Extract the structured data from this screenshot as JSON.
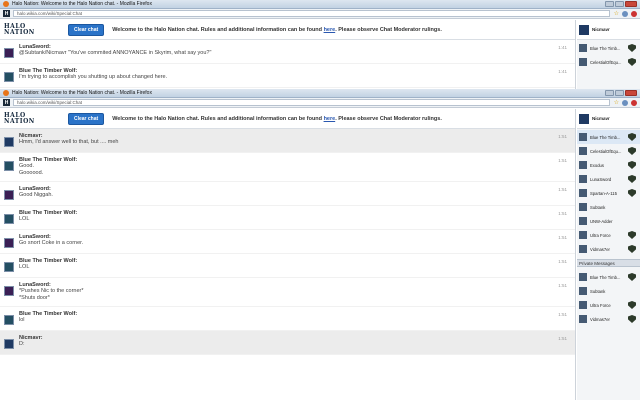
{
  "window": {
    "title": "Halo Nation: Welcome to the Halo Nation chat. - Mozilla Firefox",
    "url": "halo.wikia.com/wiki/Special:Chat"
  },
  "header": {
    "logo_line1": "HALO",
    "logo_line2": "NATION",
    "clear_chat_label": "Clear chat",
    "welcome_prefix": "Welcome to the Halo Nation chat. Rules and additional information can be found",
    "welcome_link": "here",
    "welcome_suffix": ". Please observe Chat Moderator rulings."
  },
  "back_window": {
    "messages": [
      {
        "author": "LunaSword:",
        "text": "@Subtank/Nicmavr \"You've commited ANNOYANCE in Skyrim, what say you?\"",
        "time": "1:41"
      },
      {
        "author": "Blue The Timber Wolf:",
        "text": "I'm trying to accomplish you shutting up about changed here.",
        "time": "1:41"
      }
    ],
    "self_user": "Nicmavr",
    "users": [
      "Blue The Timb...",
      "CelestialOfEqu..."
    ]
  },
  "front_window": {
    "partial_line": "Hmm, I'd answer well to that, but....",
    "messages": [
      {
        "author": "Nicmavr:",
        "text": [
          "Hmm, I'd answer well to that, but .... meh"
        ],
        "time": "1:51",
        "highlight": true
      },
      {
        "author": "Blue The Timber Wolf:",
        "text": [
          "Good.",
          "Goooood."
        ],
        "time": "1:51",
        "highlight": false
      },
      {
        "author": "LunaSword:",
        "text": [
          "Good Niggah."
        ],
        "time": "1:51",
        "highlight": false
      },
      {
        "author": "Blue The Timber Wolf:",
        "text": [
          "LOL"
        ],
        "time": "1:51",
        "highlight": false
      },
      {
        "author": "LunaSword:",
        "text": [
          "Go snort Coke in a corner."
        ],
        "time": "1:51",
        "highlight": false
      },
      {
        "author": "Blue The Timber Wolf:",
        "text": [
          "LOL"
        ],
        "time": "1:51",
        "highlight": false
      },
      {
        "author": "LunaSword:",
        "text": [
          "*Pushes Nic to the corner*",
          "*Shuts door*"
        ],
        "time": "1:51",
        "highlight": false
      },
      {
        "author": "Blue The Timber Wolf:",
        "text": [
          "lol"
        ],
        "time": "1:51",
        "highlight": false
      },
      {
        "author": "Nicmavr:",
        "text": [
          "D:"
        ],
        "time": "1:51",
        "highlight": true
      }
    ],
    "self_user": "Nicmavr",
    "users": [
      {
        "name": "Blue The Timb...",
        "mod": true,
        "selected": true
      },
      {
        "name": "CelestialOfEqu...",
        "mod": true,
        "selected": false
      },
      {
        "name": "Exodus",
        "mod": true,
        "selected": false
      },
      {
        "name": "LunaSword",
        "mod": true,
        "selected": false
      },
      {
        "name": "Spartan-A-115",
        "mod": true,
        "selected": false
      },
      {
        "name": "Subtank",
        "mod": false,
        "selected": false
      },
      {
        "name": "UNW-Adder",
        "mod": false,
        "selected": false
      },
      {
        "name": "Ultra Force",
        "mod": true,
        "selected": false
      },
      {
        "name": "Vidmas7er",
        "mod": true,
        "selected": false
      }
    ],
    "private_messages_label": "Private Messages",
    "private_users": [
      {
        "name": "Blue The Timb...",
        "mod": true
      },
      {
        "name": "Subtank",
        "mod": false
      },
      {
        "name": "Ultra Force",
        "mod": true
      },
      {
        "name": "Vidmas7er",
        "mod": true
      }
    ]
  },
  "colors": {
    "accent": "#2a73c8",
    "link": "#2a58b0",
    "highlight_row": "#ececec"
  }
}
